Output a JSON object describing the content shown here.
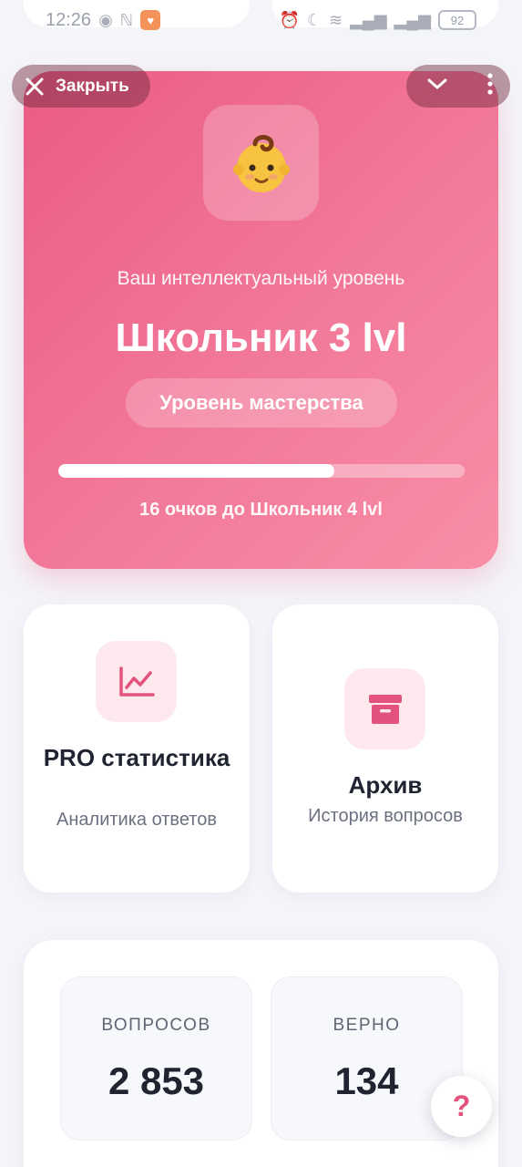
{
  "status_bar": {
    "time": "12:26",
    "battery": "92"
  },
  "overlay": {
    "close_label": "Закрыть"
  },
  "hero": {
    "emoji": "👶",
    "subtitle": "Ваш интеллектуальный уровень",
    "title": "Школьник 3 lvl",
    "mastery_button": "Уровень мастерства",
    "progress_fraction": 0.68,
    "progress_caption": "16 очков до Школьник 4 lvl"
  },
  "features": [
    {
      "title": "PRO статистика",
      "description": "Аналитика ответов",
      "icon": "chart-line-icon"
    },
    {
      "title": "Архив",
      "description": "История вопросов",
      "icon": "archive-box-icon"
    }
  ],
  "stats": [
    {
      "label": "ВОПРОСОВ",
      "value": "2 853"
    },
    {
      "label": "ВЕРНО",
      "value": "134"
    }
  ],
  "help": {
    "label": "?"
  },
  "colors": {
    "accent": "#ea5b84",
    "page_background": "#f4f5f9",
    "icon_tint": "#e2527c"
  }
}
